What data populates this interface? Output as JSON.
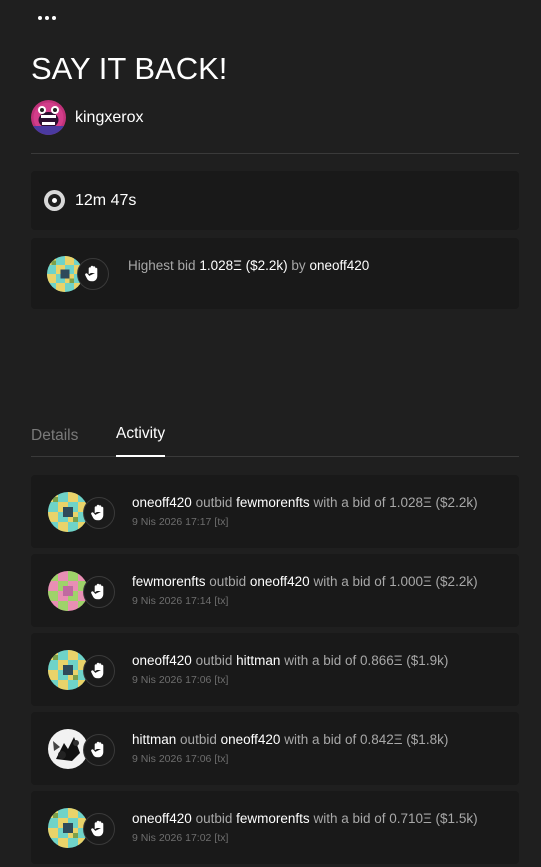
{
  "header": {
    "menu_icon": "more-horizontal-icon",
    "title": "SAY IT BACK!",
    "artist": "kingxerox"
  },
  "auction": {
    "timer": "12m 47s",
    "bid_prefix": "Highest bid",
    "bid_amount": "1.028Ξ ($2.2k)",
    "bid_by": "by",
    "bidder": "oneoff420"
  },
  "tabs": [
    {
      "label": "Details",
      "active": false
    },
    {
      "label": "Activity",
      "active": true
    }
  ],
  "activity": [
    {
      "actor": "oneoff420",
      "verb": "outbid",
      "target": "fewmorenfts",
      "text": "with a bid of 1.028Ξ ($2.2k)",
      "date": "9 Nis 2026 17:17",
      "tx": "[tx]",
      "avatar": "teal"
    },
    {
      "actor": "fewmorenfts",
      "verb": "outbid",
      "target": "oneoff420",
      "text": "with a bid of 1.000Ξ ($2.2k)",
      "date": "9 Nis 2026 17:14",
      "tx": "[tx]",
      "avatar": "pink"
    },
    {
      "actor": "oneoff420",
      "verb": "outbid",
      "target": "hittman",
      "text": "with a bid of 0.866Ξ ($1.9k)",
      "date": "9 Nis 2026 17:06",
      "tx": "[tx]",
      "avatar": "teal"
    },
    {
      "actor": "hittman",
      "verb": "outbid",
      "target": "oneoff420",
      "text": "with a bid of 0.842Ξ ($1.8k)",
      "date": "9 Nis 2026 17:06",
      "tx": "[tx]",
      "avatar": "bw"
    },
    {
      "actor": "oneoff420",
      "verb": "outbid",
      "target": "fewmorenfts",
      "text": "with a bid of 0.710Ξ ($1.5k)",
      "date": "9 Nis 2026 17:02",
      "tx": "[tx]",
      "avatar": "teal"
    }
  ]
}
